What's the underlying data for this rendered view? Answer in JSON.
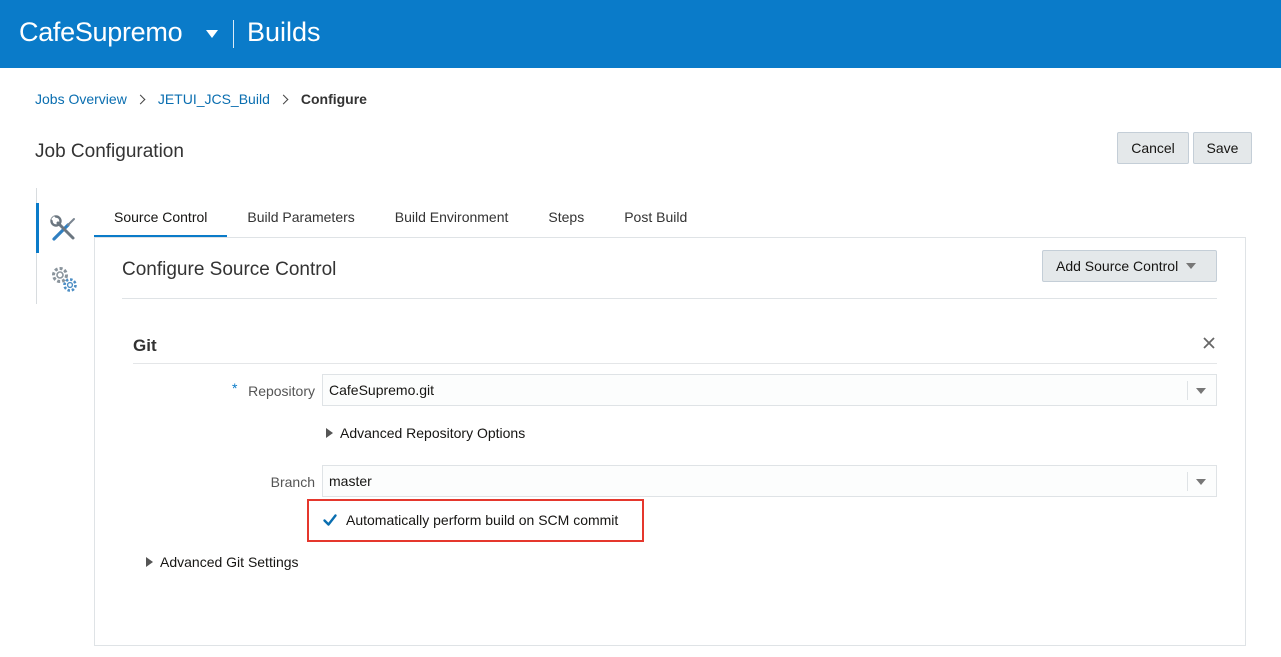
{
  "header": {
    "project": "CafeSupremo",
    "section": "Builds",
    "background": "#0a7bc9"
  },
  "breadcrumb": {
    "items": [
      "Jobs Overview",
      "JETUI_JCS_Build"
    ],
    "current": "Configure"
  },
  "page": {
    "title": "Job Configuration",
    "cancel_label": "Cancel",
    "save_label": "Save"
  },
  "side_nav": {
    "items": [
      {
        "icon": "tools-icon",
        "active": true
      },
      {
        "icon": "gears-icon",
        "active": false
      }
    ]
  },
  "tabs": [
    {
      "label": "Source Control",
      "active": true
    },
    {
      "label": "Build Parameters",
      "active": false
    },
    {
      "label": "Build Environment",
      "active": false
    },
    {
      "label": "Steps",
      "active": false
    },
    {
      "label": "Post Build",
      "active": false
    }
  ],
  "panel": {
    "title": "Configure Source Control",
    "add_button_label": "Add Source Control"
  },
  "git": {
    "title": "Git",
    "repository_label": "Repository",
    "required_marker": "*",
    "repository_value": "CafeSupremo.git",
    "advanced_repo_label": "Advanced Repository Options",
    "branch_label": "Branch",
    "branch_value": "master",
    "auto_build_label": "Automatically perform build on SCM commit",
    "auto_build_checked": true,
    "advanced_git_label": "Advanced Git Settings"
  },
  "colors": {
    "accent": "#0a7bc9",
    "highlight": "#e5372d"
  }
}
